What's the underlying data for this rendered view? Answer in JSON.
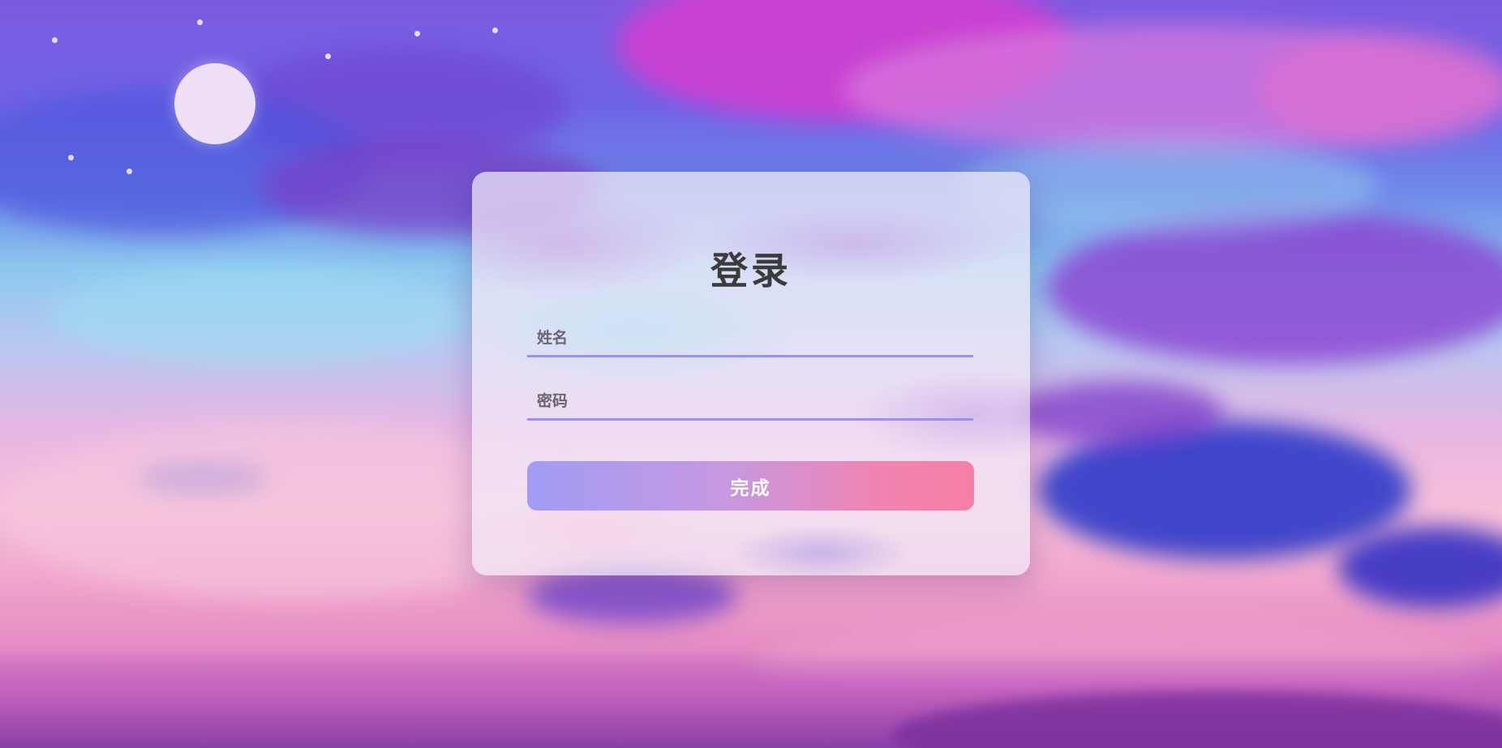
{
  "login": {
    "title": "登录",
    "name_placeholder": "姓名",
    "password_placeholder": "密码",
    "submit_label": "完成"
  },
  "colors": {
    "button_gradient_start": "#a19cf4",
    "button_gradient_end": "#f77fa6",
    "input_underline": "#9d8ff0",
    "title_text": "#3b3b3b"
  }
}
